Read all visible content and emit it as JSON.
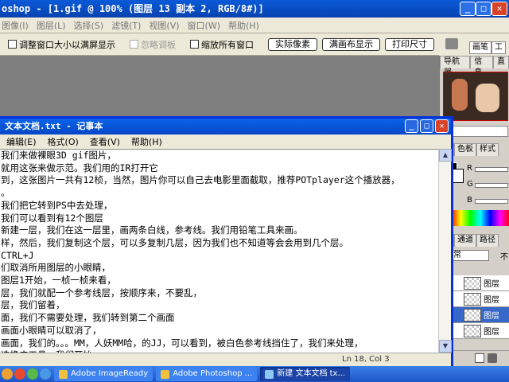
{
  "photoshop": {
    "title": "oshop - [1.gif @ 100% (图层 13 副本 2, RGB/8#)]",
    "menu": [
      "图像(I)",
      "图层(L)",
      "选择(S)",
      "滤镜(T)",
      "视图(V)",
      "窗口(W)",
      "帮助(H)"
    ],
    "options": {
      "resize_window_label": "调整窗口大小以满屏显示",
      "ignore_palettes_label": "忽略调板",
      "zoom_all_label": "缩放所有窗口",
      "actual_pixels": "实际像素",
      "fit_screen": "满画布显示",
      "print_size": "打印尺寸"
    },
    "palette_tabs": [
      "画笔",
      "工"
    ],
    "navigator_tabs": [
      "导航器",
      "信息",
      "直"
    ],
    "color_tabs": [
      "色",
      "色板",
      "样式"
    ],
    "color_channels": [
      "R",
      "G",
      "B"
    ],
    "layers_tabs": [
      "层",
      "通道",
      "路径"
    ],
    "blend_mode": "常",
    "opacity_label": "不",
    "layers": [
      {
        "name": "图层",
        "selected": false
      },
      {
        "name": "图层",
        "selected": false
      },
      {
        "name": "图层",
        "selected": true
      },
      {
        "name": "图层",
        "selected": false
      }
    ]
  },
  "notepad": {
    "title": "文本文档.txt - 记事本",
    "menu": [
      "编辑(E)",
      "格式(O)",
      "查看(V)",
      "帮助(H)"
    ],
    "lines": [
      "我们来做裸眼3D gif图片，",
      "就用这张来做示范。我们用的IR打开它",
      "到，这张图片一共有12桢，当然，图片你可以自己去电影里面截取，推荐POTplayer这个播放器，",
      "。",
      "我们把它转到PS中去处理，",
      "我们可以看到有12个图层",
      "新建一层，我们在这一层里，画两条白线，参考线。我们用铅笔工具来画。",
      "样，然后，我们复制这个层，可以多复制几层，因为我们也不知道等会会用到几个层。",
      "CTRL+J",
      "们取消所用图层的小眼睛，",
      "图层1开始，一桢一桢来看，",
      "层，我们就配一个参考线层，按顺序来，不要乱，",
      "层，我们留着，",
      "面，我们不需要处理，我们转到第二个画面",
      "画面小眼睛可以取消了，",
      "画面，我们的。。。MM，人妖MM哈，的JJ，可以看到，被白色参考线挡住了，我们来处理，",
      "选橡皮工具，我们开始，",
      "我们把小眼睛去掉，转下一个画面，"
    ],
    "status": "Ln 18, Col 3"
  },
  "taskbar": {
    "items": [
      {
        "label": "Adobe ImageReady",
        "active": false
      },
      {
        "label": "Adobe Photoshop ...",
        "active": false
      },
      {
        "label": "新建 文本文档 tx...",
        "active": true
      }
    ]
  }
}
